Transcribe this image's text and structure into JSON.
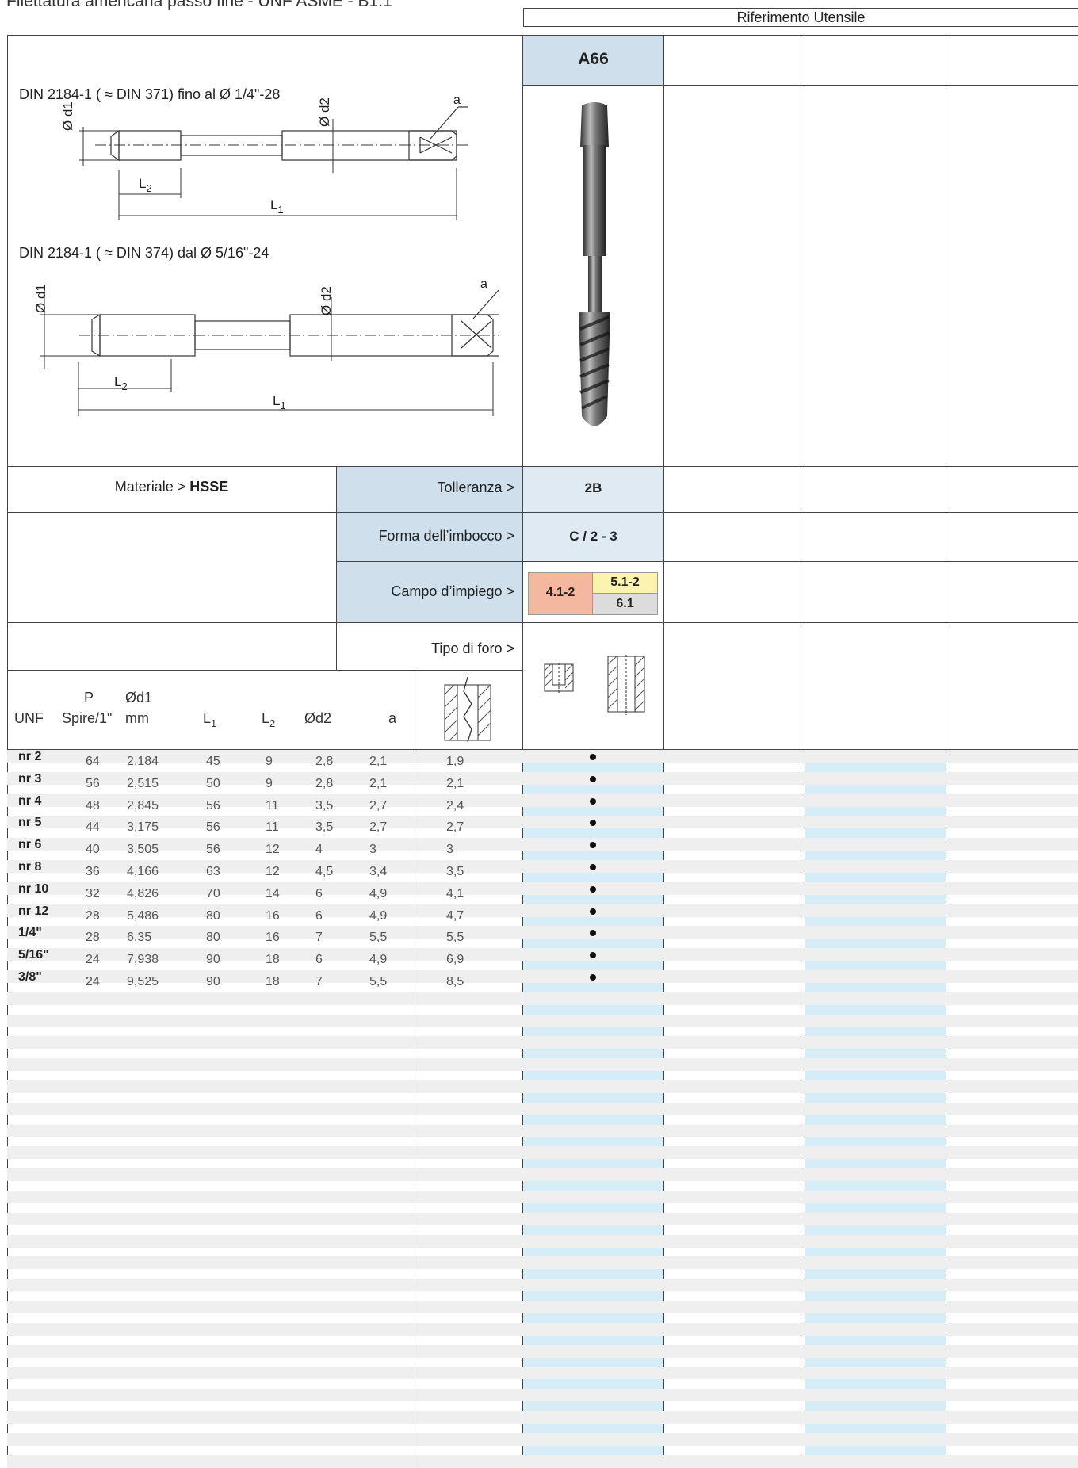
{
  "page_title": "Filettatura americana passo fine - UNF ASME - B1.1",
  "reference_header": "Riferimento Utensile",
  "tool_code": "A66",
  "drawing1": {
    "caption": "DIN 2184-1 ( ≈ DIN 371) fino al Ø 1/4\"-28",
    "d1_label": "Ø d1",
    "d2_label": "Ø d2",
    "a_label": "a",
    "L2_main": "L",
    "L2_sub": "2",
    "L1_main": "L",
    "L1_sub": "1"
  },
  "drawing2": {
    "caption": "DIN 2184-1 ( ≈ DIN 374) dal Ø 5/16\"-24",
    "d1_label": "Ø d1",
    "d2_label": "Ø d2",
    "a_label": "a",
    "L2_main": "L",
    "L2_sub": "2",
    "L1_main": "L",
    "L1_sub": "1"
  },
  "material_label": "Materiale > ",
  "material_value": "HSSE",
  "tolerance_label": "Tolleranza >",
  "tolerance_value": "2B",
  "chamfer_label": "Forma dell’imbocco >",
  "chamfer_value": "C / 2 - 3",
  "application_label": "Campo d’impiego >",
  "application_values": {
    "main": "4.1-2",
    "top": "5.1-2",
    "bottom": "6.1"
  },
  "colors": {
    "app_main": "#f4b8a0",
    "app_top": "#fdf3b0",
    "app_bottom": "#dcdcdc",
    "header_blue": "#cfe0ec",
    "column_highlight": "#cdeaf6"
  },
  "hole_type_label": "Tipo di foro >",
  "table_headers": {
    "unf": "UNF",
    "p_top": "P",
    "p_bottom": "Spire/1\"",
    "d1_top": "Ød1",
    "d1_bottom": "mm",
    "l1_main": "L",
    "l1_sub": "1",
    "l2_main": "L",
    "l2_sub": "2",
    "d2": "Ød2",
    "a": "a"
  },
  "rows": [
    {
      "size": "nr 2",
      "p": "64",
      "d1": "2,184",
      "l1": "45",
      "l2": "9",
      "d2": "2,8",
      "a": "2,1",
      "drill": "1,9"
    },
    {
      "size": "nr 3",
      "p": "56",
      "d1": "2,515",
      "l1": "50",
      "l2": "9",
      "d2": "2,8",
      "a": "2,1",
      "drill": "2,1"
    },
    {
      "size": "nr 4",
      "p": "48",
      "d1": "2,845",
      "l1": "56",
      "l2": "11",
      "d2": "3,5",
      "a": "2,7",
      "drill": "2,4"
    },
    {
      "size": "nr 5",
      "p": "44",
      "d1": "3,175",
      "l1": "56",
      "l2": "11",
      "d2": "3,5",
      "a": "2,7",
      "drill": "2,7"
    },
    {
      "size": "nr 6",
      "p": "40",
      "d1": "3,505",
      "l1": "56",
      "l2": "12",
      "d2": "4",
      "a": "3",
      "drill": "3"
    },
    {
      "size": "nr 8",
      "p": "36",
      "d1": "4,166",
      "l1": "63",
      "l2": "12",
      "d2": "4,5",
      "a": "3,4",
      "drill": "3,5"
    },
    {
      "size": "nr 10",
      "p": "32",
      "d1": "4,826",
      "l1": "70",
      "l2": "14",
      "d2": "6",
      "a": "4,9",
      "drill": "4,1"
    },
    {
      "size": "nr 12",
      "p": "28",
      "d1": "5,486",
      "l1": "80",
      "l2": "16",
      "d2": "6",
      "a": "4,9",
      "drill": "4,7"
    },
    {
      "size": "1/4\"",
      "p": "28",
      "d1": "6,35",
      "l1": "80",
      "l2": "16",
      "d2": "7",
      "a": "5,5",
      "drill": "5,5"
    },
    {
      "size": "5/16\"",
      "p": "24",
      "d1": "7,938",
      "l1": "90",
      "l2": "18",
      "d2": "6",
      "a": "4,9",
      "drill": "6,9"
    },
    {
      "size": "3/8\"",
      "p": "24",
      "d1": "9,525",
      "l1": "90",
      "l2": "18",
      "d2": "7",
      "a": "5,5",
      "drill": "8,5"
    }
  ]
}
